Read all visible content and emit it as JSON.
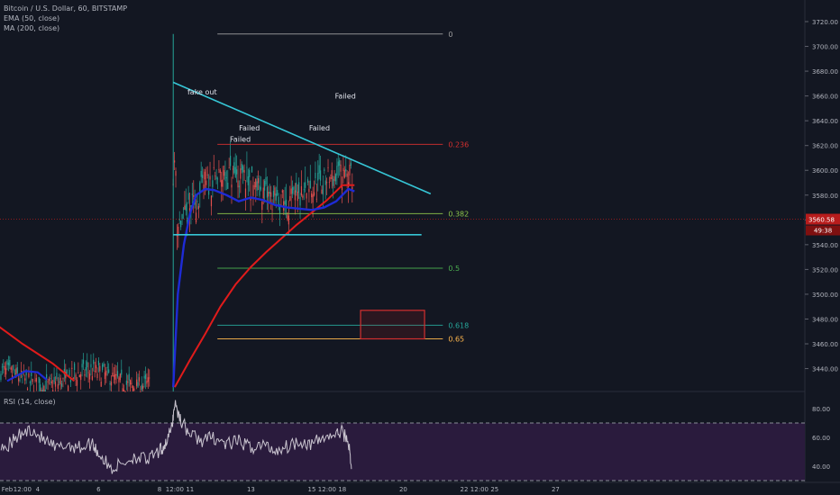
{
  "legend": {
    "symbol": "Bitcoin / U.S. Dollar, 60, BITSTAMP",
    "ema": "EMA (50, close)",
    "ma": "MA (200, close)",
    "rsi": "RSI (14, close)"
  },
  "price_tag": {
    "price": "3560.58",
    "countdown": "49:38"
  },
  "colors": {
    "background": "#131722",
    "ema": "#1e2bd6",
    "ma": "#e01b1b",
    "trendline": "#36c6d6",
    "rsi_band": "#2a1b3d",
    "price_tag": "#b71c1c"
  },
  "chart_data": {
    "type": "line",
    "title": "",
    "y_axis": {
      "ticks": [
        3440,
        3460,
        3480,
        3500,
        3520,
        3540,
        3560,
        3580,
        3600,
        3620,
        3640,
        3660,
        3680,
        3700,
        3720
      ],
      "range": [
        3425,
        3728
      ]
    },
    "x_axis": {
      "ticks": [
        {
          "label": "Feb",
          "day": 1
        },
        {
          "label": "12:00",
          "day": 1.5
        },
        {
          "label": "4",
          "day": 2
        },
        {
          "label": "6",
          "day": 4
        },
        {
          "label": "8",
          "day": 6
        },
        {
          "label": "12:00",
          "day": 6.5
        },
        {
          "label": "11",
          "day": 7
        },
        {
          "label": "13",
          "day": 9
        },
        {
          "label": "15",
          "day": 11
        },
        {
          "label": "12:00",
          "day": 11.5
        },
        {
          "label": "18",
          "day": 12
        },
        {
          "label": "20",
          "day": 14
        },
        {
          "label": "22",
          "day": 16
        },
        {
          "label": "12:00",
          "day": 16.5
        },
        {
          "label": "25",
          "day": 17
        },
        {
          "label": "27",
          "day": 19
        }
      ]
    },
    "last_price": 3560.58,
    "fibonacci": [
      {
        "label": "0",
        "price": 3710,
        "color": "#9e9e9e"
      },
      {
        "label": "0.236",
        "price": 3621,
        "color": "#d32f2f"
      },
      {
        "label": "0.382",
        "price": 3565,
        "color": "#8bc34a"
      },
      {
        "label": "0.5",
        "price": 3521,
        "color": "#4caf50"
      },
      {
        "label": "0.618",
        "price": 3475,
        "color": "#26a69a"
      },
      {
        "label": "0.65",
        "price": 3464,
        "color": "#ffb74d"
      }
    ],
    "annotations": [
      {
        "text": "fake out",
        "day": 7.4,
        "price": 3661
      },
      {
        "text": "Failed",
        "day": 8.95,
        "price": 3632
      },
      {
        "text": "Failed",
        "day": 8.65,
        "price": 3623
      },
      {
        "text": "Failed",
        "day": 11.25,
        "price": 3632
      },
      {
        "text": "Failed",
        "day": 12.1,
        "price": 3658
      }
    ],
    "trendlines": [
      {
        "name": "resistance",
        "from": {
          "day": 6.45,
          "price": 3671
        },
        "to": {
          "day": 14.9,
          "price": 3581
        }
      },
      {
        "name": "support",
        "from": {
          "day": 6.45,
          "price": 3548
        },
        "to": {
          "day": 14.6,
          "price": 3548
        }
      }
    ],
    "target_box": {
      "day_from": 12.6,
      "day_to": 14.7,
      "price_from": 3464,
      "price_to": 3487
    },
    "ema_50": {
      "x": [
        6.45,
        6.6,
        6.8,
        7.0,
        7.2,
        7.5,
        7.8,
        8.2,
        8.6,
        9.0,
        9.4,
        9.8,
        10.2,
        10.6,
        11.0,
        11.4,
        11.8,
        12.2,
        12.4
      ],
      "y": [
        3425,
        3500,
        3540,
        3565,
        3580,
        3585,
        3584,
        3580,
        3575,
        3578,
        3576,
        3572,
        3570,
        3569,
        3568,
        3570,
        3575,
        3585,
        3583
      ]
    },
    "ma_200": {
      "x": [
        6.5,
        7.0,
        7.5,
        8.0,
        8.5,
        9.0,
        9.5,
        10.0,
        10.5,
        11.0,
        11.5,
        12.0,
        12.4
      ],
      "y": [
        3425,
        3447,
        3468,
        3490,
        3508,
        3522,
        3534,
        3545,
        3556,
        3566,
        3576,
        3588,
        3588
      ]
    },
    "ema_50_prior": {
      "x": [
        1.0,
        1.3,
        1.6,
        2.0,
        2.3
      ],
      "y": [
        3430,
        3434,
        3438,
        3437,
        3431
      ]
    },
    "ma_200_prior": {
      "x": [
        -1.0,
        -0.5,
        0.0,
        0.5,
        1.0,
        1.5,
        2.0,
        2.5,
        3.0,
        3.2
      ],
      "y": [
        3505,
        3496,
        3487,
        3478,
        3469,
        3460,
        3452,
        3444,
        3434,
        3430
      ]
    },
    "rsi": {
      "range": [
        30,
        90
      ],
      "ticks": [
        40,
        60,
        80
      ],
      "upper_band": 70,
      "lower_band": 30,
      "x": [
        -1.0,
        -0.6,
        -0.2,
        0.2,
        0.6,
        1.0,
        1.4,
        1.8,
        2.2,
        2.6,
        3.0,
        3.4,
        3.8,
        4.0,
        4.4,
        4.8,
        5.2,
        5.6,
        6.0,
        6.2,
        6.4,
        6.5,
        6.7,
        7.0,
        7.4,
        7.8,
        8.2,
        8.6,
        9.0,
        9.4,
        9.8,
        10.2,
        10.6,
        11.0,
        11.4,
        11.8,
        12.0,
        12.2,
        12.3
      ],
      "y": [
        57,
        55,
        52,
        60,
        57,
        54,
        61,
        66,
        58,
        52,
        55,
        53,
        56,
        49,
        38,
        42,
        47,
        44,
        50,
        56,
        66,
        84,
        72,
        62,
        58,
        60,
        55,
        57,
        53,
        55,
        51,
        54,
        58,
        55,
        60,
        62,
        64,
        57,
        38
      ]
    }
  }
}
